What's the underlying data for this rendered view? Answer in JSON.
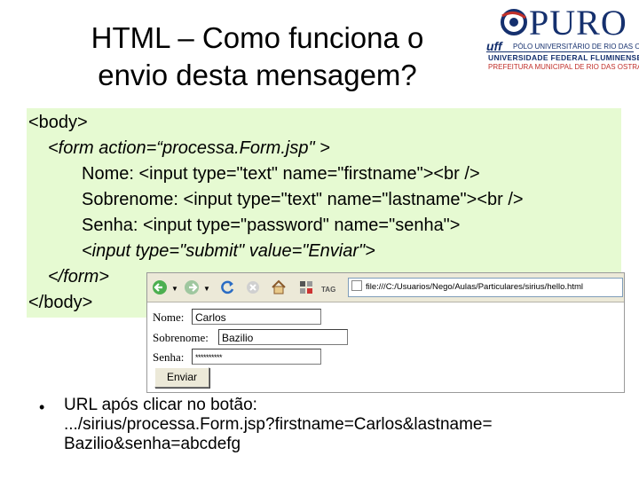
{
  "title": {
    "line1": "HTML – Como funciona o",
    "line2": "envio desta mensagem?"
  },
  "logo": {
    "brand": "PURO",
    "uff": "uff",
    "line1": "PÓLO UNIVERSITÁRIO DE RIO DAS OSTRAS",
    "line2": "UNIVERSIDADE FEDERAL FLUMINENSE",
    "line3": "PREFEITURA MUNICIPAL DE RIO DAS OSTRAS"
  },
  "code": {
    "lines": [
      "<body>",
      "<form action=“processa.Form.jsp\" >",
      "Nome: <input type=\"text\" name=\"firstname\"><br />",
      "Sobrenome: <input type=\"text\" name=\"lastname\"><br />",
      "Senha: <input type=\"password\" name=\"senha\">",
      "<input type=\"submit\" value=\"Enviar\">",
      "</form>",
      "</body>"
    ]
  },
  "browser": {
    "url": "file:///C:/Usuarios/Nego/Aulas/Particulares/sirius/hello.html",
    "tag_label": "TAG",
    "form": {
      "nome_label": "Nome:",
      "nome_value": "Carlos",
      "sobrenome_label": "Sobrenome:",
      "sobrenome_value": "Bazilio",
      "senha_label": "Senha:",
      "senha_value": "**********",
      "submit_label": "Enviar"
    }
  },
  "bullet": {
    "line1": "URL após clicar no botão:",
    "line2": ".../sirius/processa.Form.jsp?firstname=Carlos&lastname=",
    "line3": "Bazilio&senha=abcdefg"
  },
  "colors": {
    "code_bg": "#e6fad2",
    "logo_blue": "#15306e",
    "logo_red": "#c0302a"
  }
}
